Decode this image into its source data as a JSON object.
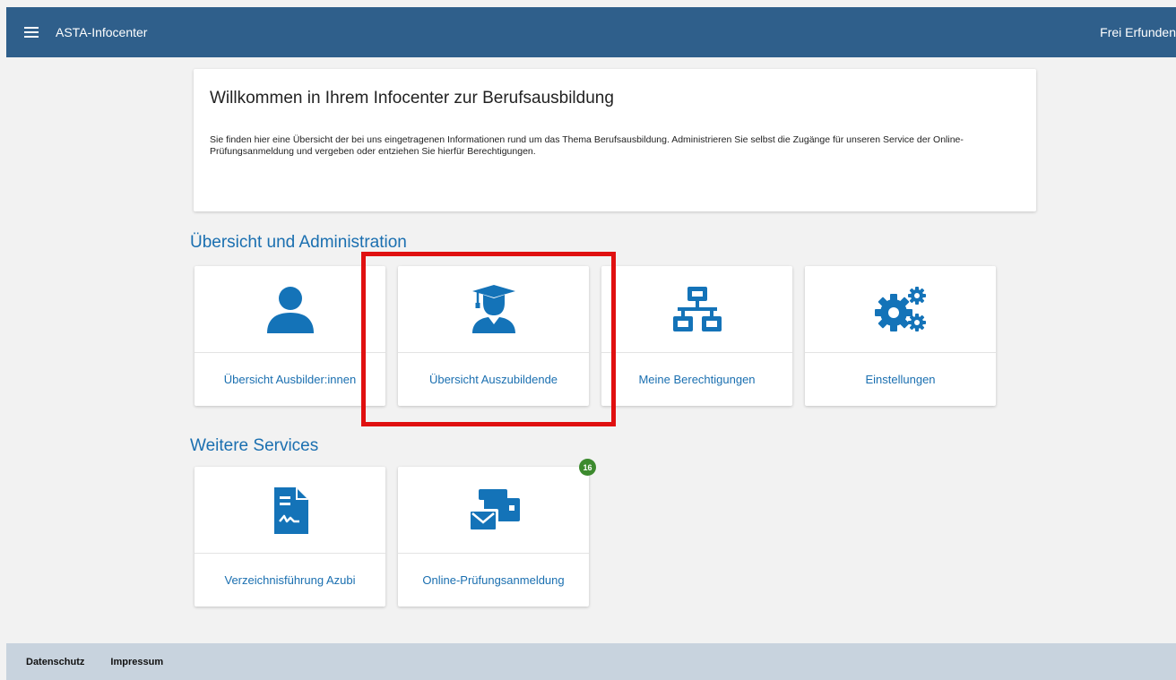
{
  "header": {
    "app_title": "ASTA-Infocenter",
    "user_name": "Frei Erfunden"
  },
  "welcome": {
    "title": "Willkommen in Ihrem Infocenter zur Berufsausbildung",
    "text": "Sie finden hier eine Übersicht der bei uns eingetragenen Informationen rund um das Thema Berufsausbildung. Administrieren Sie selbst die Zugänge für unseren Service der Online-Prüfungsanmeldung und vergeben oder entziehen Sie hierfür Berechtigungen."
  },
  "sections": [
    {
      "title": "Übersicht und Administration",
      "tiles": [
        {
          "label": "Übersicht Ausbilder:innen",
          "icon": "user-icon"
        },
        {
          "label": "Übersicht Auszubildende",
          "icon": "graduate-icon"
        },
        {
          "label": "Meine Berechtigungen",
          "icon": "network-icon"
        },
        {
          "label": "Einstellungen",
          "icon": "gears-icon"
        }
      ]
    },
    {
      "title": "Weitere Services",
      "tiles": [
        {
          "label": "Verzeichnisführung Azubi",
          "icon": "document-signature-icon"
        },
        {
          "label": "Online-Prüfungsanmeldung",
          "icon": "mail-envelope-icon",
          "badge": "16"
        }
      ]
    }
  ],
  "footer": {
    "privacy": "Datenschutz",
    "imprint": "Impressum"
  },
  "colors": {
    "header_bg": "#2f5f8b",
    "accent": "#1a6fb0",
    "icon": "#1473b8",
    "badge": "#3c8a2e",
    "highlight": "#e01010",
    "footer_bg": "#c8d3de"
  }
}
